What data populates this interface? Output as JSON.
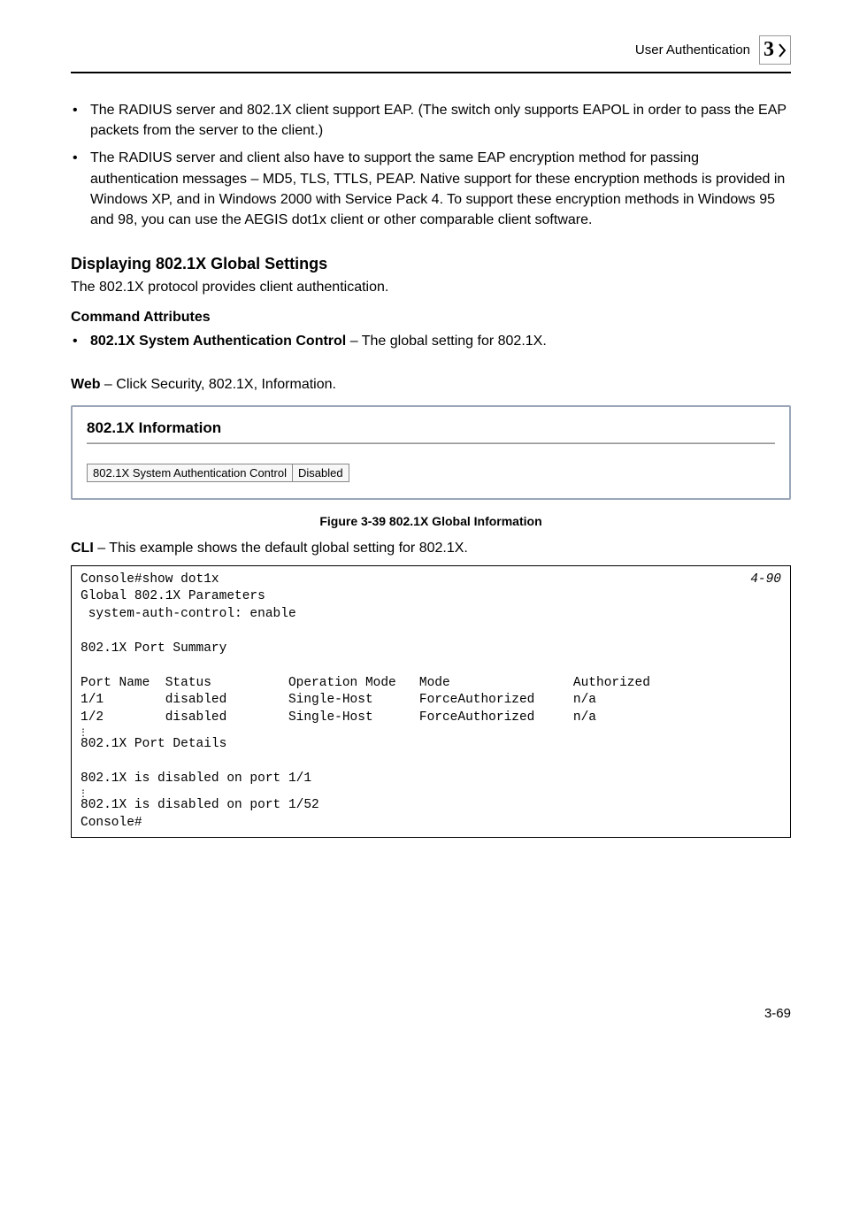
{
  "header": {
    "section": "User Authentication",
    "chapter": "3"
  },
  "bullets": [
    "The RADIUS server and 802.1X client support EAP. (The switch only supports EAPOL in order to pass the EAP packets from the server to the client.)",
    "The RADIUS server and client also have to support the same EAP encryption method for passing authentication messages – MD5, TLS, TTLS, PEAP. Native support for these encryption methods is provided in Windows XP, and in Windows 2000 with Service Pack 4. To support these encryption methods in Windows 95 and 98, you can use the AEGIS dot1x client or other comparable client software."
  ],
  "section_title": "Displaying 802.1X Global Settings",
  "section_body": "The 802.1X protocol provides client authentication.",
  "cmd_attr_head": "Command Attributes",
  "cmd_attr_bold": "802.1X System Authentication Control",
  "cmd_attr_rest": " – The global setting for 802.1X.",
  "web_bold": "Web",
  "web_rest": " – Click Security, 802.1X, Information.",
  "screenshot": {
    "title": "802.1X Information",
    "field_label": "802.1X System Authentication Control",
    "field_value": "Disabled"
  },
  "figure_caption": "Figure 3-39  802.1X Global Information",
  "cli_bold": "CLI",
  "cli_rest": " – This example shows the default global setting for 802.1X.",
  "cli": {
    "ref": "4-90",
    "line1": "Console#show dot1x",
    "line2": "Global 802.1X Parameters",
    "line3": " system-auth-control: enable",
    "line5": "802.1X Port Summary",
    "hdr": "Port Name  Status          Operation Mode   Mode                Authorized",
    "row1": "1/1        disabled        Single-Host      ForceAuthorized     n/a",
    "row2": "1/2        disabled        Single-Host      ForceAuthorized     n/a",
    "details": "802.1X Port Details",
    "dis1": "802.1X is disabled on port 1/1",
    "dis2": "802.1X is disabled on port 1/52",
    "prompt": "Console#"
  },
  "footer": "3-69"
}
